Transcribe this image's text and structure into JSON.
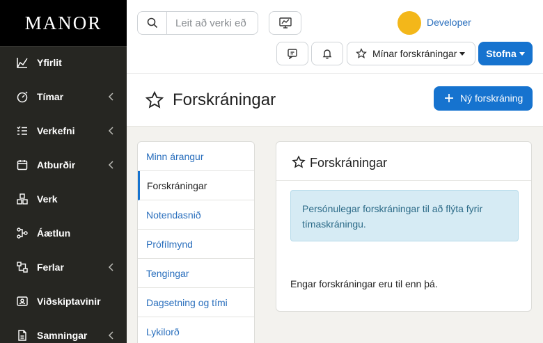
{
  "app": {
    "logo": "MANOR"
  },
  "sidebar": {
    "items": [
      {
        "label": "Yfirlit",
        "icon": "chart-line-icon",
        "has_submenu": false
      },
      {
        "label": "Tímar",
        "icon": "timer-icon",
        "has_submenu": true
      },
      {
        "label": "Verkefni",
        "icon": "task-list-icon",
        "has_submenu": true
      },
      {
        "label": "Atburðir",
        "icon": "calendar-icon",
        "has_submenu": true
      },
      {
        "label": "Verk",
        "icon": "cubes-icon",
        "has_submenu": false
      },
      {
        "label": "Áætlun",
        "icon": "sitemap-icon",
        "has_submenu": false
      },
      {
        "label": "Ferlar",
        "icon": "workflow-icon",
        "has_submenu": true
      },
      {
        "label": "Viðskiptavinir",
        "icon": "contact-card-icon",
        "has_submenu": false
      },
      {
        "label": "Samningar",
        "icon": "document-icon",
        "has_submenu": true
      }
    ]
  },
  "header": {
    "search": {
      "placeholder": "Leit að verki eð",
      "value": ""
    },
    "user": {
      "name": "Developer",
      "avatar_color": "#f3b71a"
    },
    "presets_label": "Mínar forskráningar",
    "create_label": "Stofna"
  },
  "page": {
    "title": "Forskráningar",
    "new_button_label": "Ný forskráning"
  },
  "submenu": {
    "items": [
      {
        "label": "Minn árangur",
        "active": false
      },
      {
        "label": "Forskráningar",
        "active": true
      },
      {
        "label": "Notendasnið",
        "active": false
      },
      {
        "label": "Prófílmynd",
        "active": false
      },
      {
        "label": "Tengingar",
        "active": false
      },
      {
        "label": "Dagsetning og tími",
        "active": false
      },
      {
        "label": "Lykilorð",
        "active": false
      }
    ]
  },
  "card": {
    "title": "Forskráningar",
    "info": "Persónulegar forskráningar til að flýta fyrir tímaskráningu.",
    "empty_message": "Engar forskráningar eru til enn þá."
  },
  "colors": {
    "primary": "#1673cf",
    "sidebar_bg": "#262622",
    "link": "#2a6fbd",
    "alert_bg": "#d6ebf4"
  }
}
